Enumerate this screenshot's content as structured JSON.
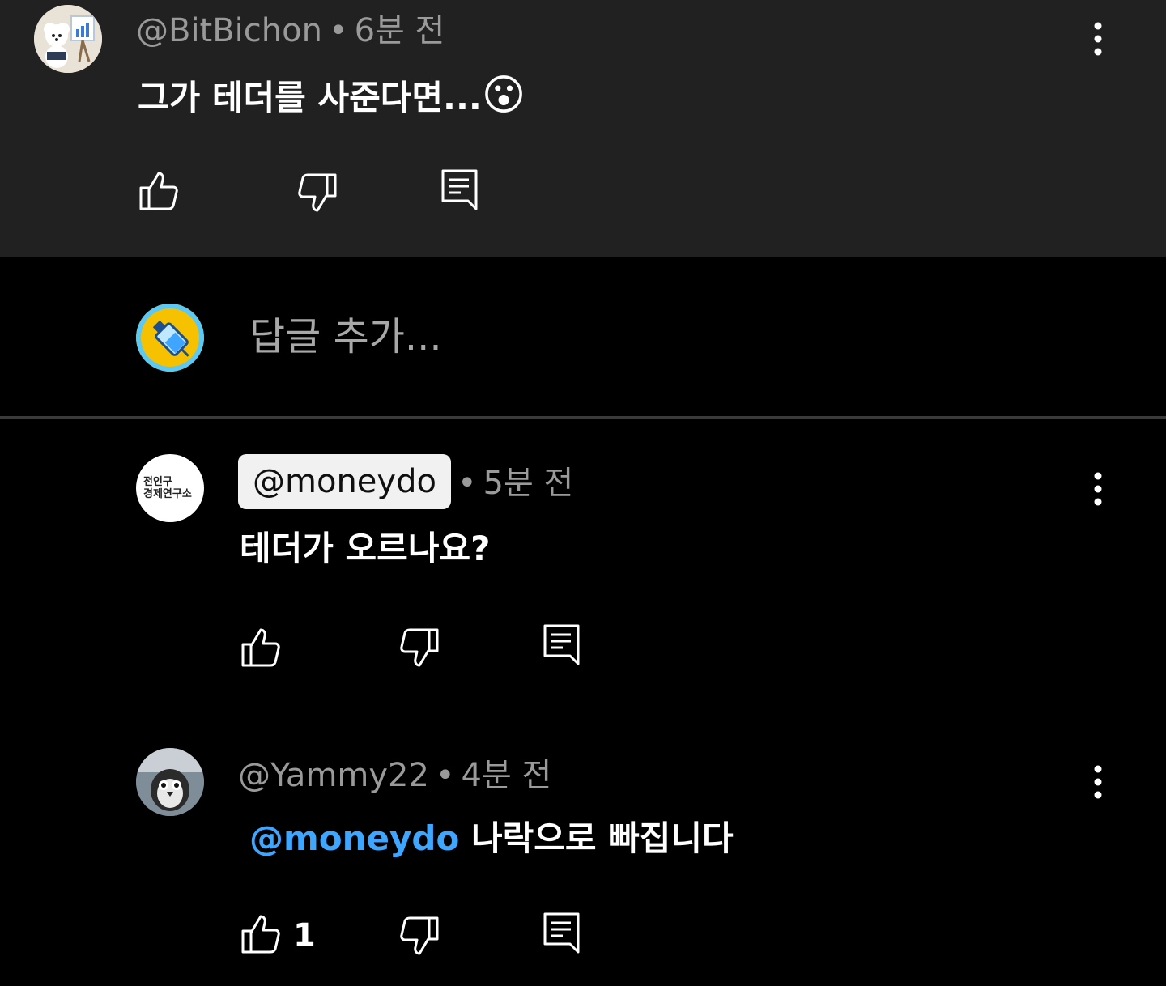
{
  "parent_comment": {
    "author": "@BitBichon",
    "time": "6분 전",
    "text": "그가 테더를 사준다면...",
    "emoji": "😮",
    "avatar_icon": "avatar-bichon-icon"
  },
  "reply_box": {
    "placeholder": "답글 추가...",
    "avatar_icon": "avatar-syringe-icon"
  },
  "replies": [
    {
      "author": "@moneydo",
      "time": "5분 전",
      "text": "테더가 오르나요?",
      "likes": "",
      "avatar_text_top": "전인구",
      "avatar_text_bottom": "경제연구소"
    },
    {
      "author": "@Yammy22",
      "time": "4분 전",
      "mention": "@moneydo",
      "text": "나락으로 빠집니다",
      "likes": "1",
      "avatar_icon": "avatar-penguin-icon"
    }
  ],
  "separator": "•",
  "colors": {
    "panel": "#212121",
    "background": "#000000",
    "meta": "#9a9a9a",
    "mention": "#3ea6ff",
    "chip": "#f1f1f1"
  }
}
